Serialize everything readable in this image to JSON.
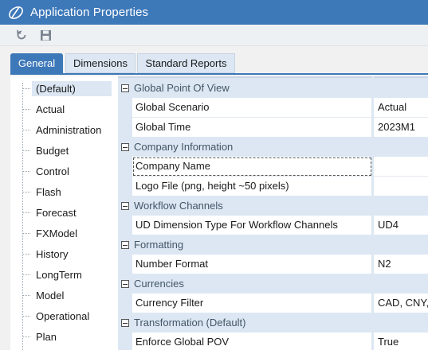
{
  "window": {
    "title": "Application Properties"
  },
  "toolbar": {
    "buttons": [
      "refresh-icon",
      "save-icon"
    ]
  },
  "tabs": [
    {
      "label": "General",
      "active": true
    },
    {
      "label": "Dimensions",
      "active": false
    },
    {
      "label": "Standard Reports",
      "active": false
    }
  ],
  "tree": {
    "items": [
      "(Default)",
      "Actual",
      "Administration",
      "Budget",
      "Control",
      "Flash",
      "Forecast",
      "FXModel",
      "History",
      "LongTerm",
      "Model",
      "Operational",
      "Plan"
    ],
    "selected": "(Default)"
  },
  "properties": {
    "categories": [
      {
        "label": "Global Point Of View",
        "rows": [
          {
            "name": "Global Scenario",
            "value": "Actual"
          },
          {
            "name": "Global Time",
            "value": "2023M1"
          }
        ]
      },
      {
        "label": "Company Information",
        "rows": [
          {
            "name": "Company Name",
            "value": ""
          },
          {
            "name": "Logo File (png, height ~50 pixels)",
            "value": ""
          }
        ]
      },
      {
        "label": "Workflow Channels",
        "rows": [
          {
            "name": "UD Dimension Type For Workflow Channels",
            "value": "UD4"
          }
        ]
      },
      {
        "label": "Formatting",
        "rows": [
          {
            "name": "Number Format",
            "value": "N2"
          }
        ]
      },
      {
        "label": "Currencies",
        "rows": [
          {
            "name": "Currency Filter",
            "value": "CAD, CNY,"
          }
        ]
      },
      {
        "label": "Transformation (Default)",
        "rows": [
          {
            "name": "Enforce Global POV",
            "value": "True"
          }
        ]
      }
    ]
  },
  "colors": {
    "accent": "#3d78b9",
    "category_bg": "#dce7f3"
  }
}
